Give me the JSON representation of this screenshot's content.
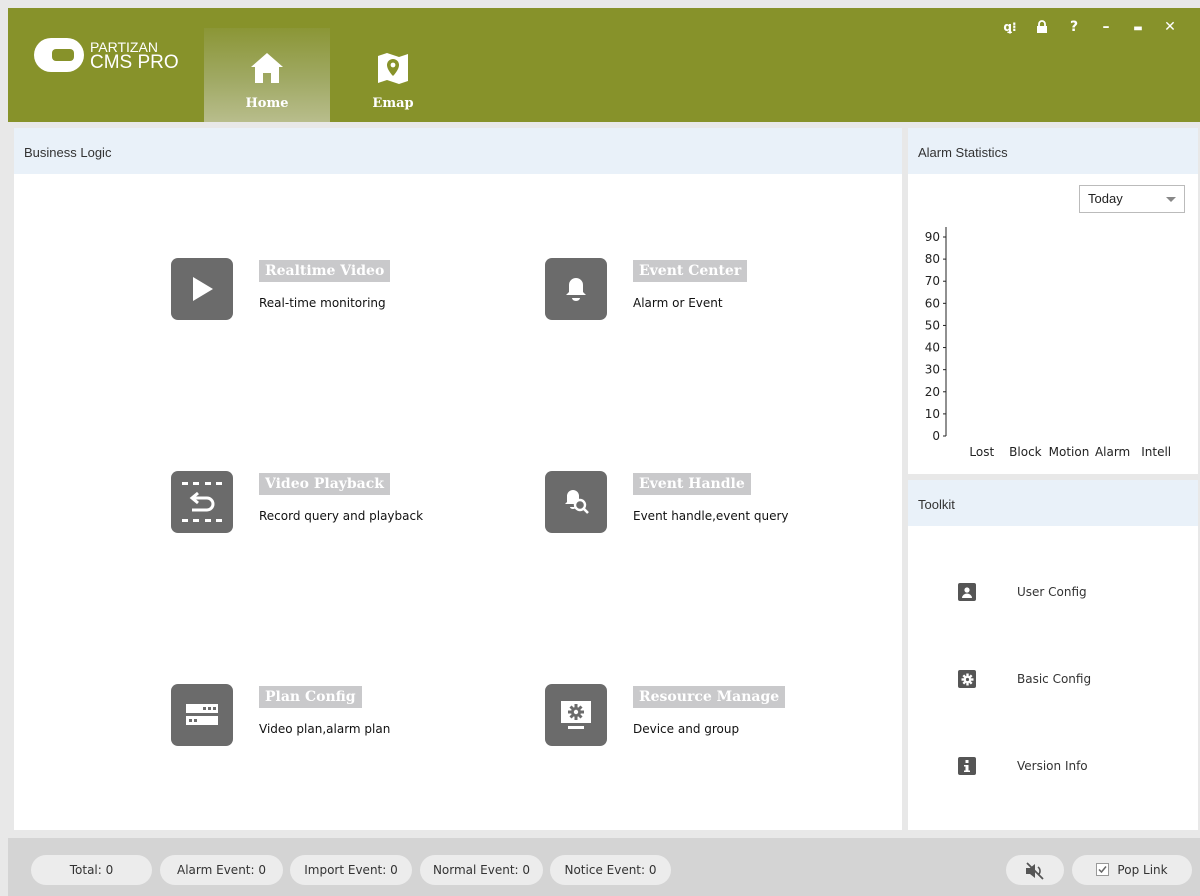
{
  "header": {
    "logo_line1": "PARTIZAN",
    "logo_line2": "CMS PRO",
    "tabs": [
      {
        "label": "Home",
        "icon": "home-icon",
        "active": true
      },
      {
        "label": "Emap",
        "icon": "map-pin-icon",
        "active": false
      }
    ],
    "window_controls": [
      {
        "icon": "user-switch-icon",
        "glyph": "ꝗ⁝"
      },
      {
        "icon": "lock-icon",
        "glyph": "🔒︎"
      },
      {
        "icon": "help-icon",
        "glyph": "?"
      },
      {
        "icon": "minimize-icon",
        "glyph": "–"
      },
      {
        "icon": "maximize-icon",
        "glyph": "▬"
      },
      {
        "icon": "close-icon",
        "glyph": "✕"
      }
    ]
  },
  "business": {
    "title": "Business Logic",
    "items": [
      {
        "title": "Realtime Video",
        "desc": "Real-time monitoring",
        "icon": "play-icon"
      },
      {
        "title": "Event Center",
        "desc": "Alarm or Event",
        "icon": "bell-icon"
      },
      {
        "title": "Video Playback",
        "desc": "Record query and playback",
        "icon": "playback-icon"
      },
      {
        "title": "Event Handle",
        "desc": "Event handle,event query",
        "icon": "event-search-icon"
      },
      {
        "title": "Plan Config",
        "desc": "Video plan,alarm plan",
        "icon": "plan-icon"
      },
      {
        "title": "Resource Manage",
        "desc": "Device and group",
        "icon": "resource-monitor-icon"
      }
    ]
  },
  "alarm": {
    "title": "Alarm Statistics",
    "period": "Today"
  },
  "chart_data": {
    "type": "bar",
    "categories": [
      "Lost",
      "Block",
      "Motion",
      "Alarm",
      "Intell"
    ],
    "values": [
      0,
      0,
      0,
      0,
      0
    ],
    "yticks": [
      "0",
      "10",
      "20",
      "30",
      "40",
      "50",
      "60",
      "70",
      "80",
      "90"
    ],
    "ylim": [
      0,
      90
    ]
  },
  "toolkit": {
    "title": "Toolkit",
    "items": [
      {
        "label": "User Config",
        "icon": "user-icon"
      },
      {
        "label": "Basic Config",
        "icon": "gear-icon"
      },
      {
        "label": "Version Info",
        "icon": "info-icon"
      }
    ]
  },
  "footer": {
    "total": "Total: 0",
    "alarm_event": "Alarm Event: 0",
    "import_event": "Import Event: 0",
    "normal_event": "Normal Event: 0",
    "notice_event": "Notice Event: 0",
    "pop_link": "Pop Link"
  },
  "colors": {
    "header": "#87922a",
    "panel_head": "#e9f1f9",
    "icon_tile": "#6b6b6b",
    "title_tag": "#c9c9cb"
  }
}
